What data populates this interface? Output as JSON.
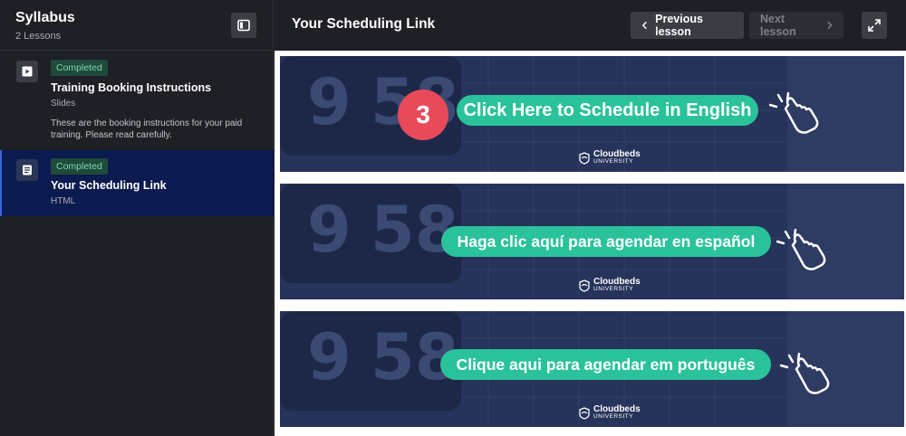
{
  "sidebar": {
    "title": "Syllabus",
    "subtitle": "2 Lessons",
    "lessons": [
      {
        "status": "Completed",
        "title": "Training Booking Instructions",
        "type": "Slides",
        "description": "These are the booking instructions for your paid training. Please read carefully.",
        "icon": "play-icon"
      },
      {
        "status": "Completed",
        "title": "Your Scheduling Link",
        "type": "HTML",
        "icon": "document-icon",
        "active": true
      }
    ]
  },
  "header": {
    "title": "Your Scheduling Link",
    "prev_label": "Previous lesson",
    "next_label": "Next lesson"
  },
  "banners": [
    {
      "number": "3",
      "label": "Click Here to Schedule in English"
    },
    {
      "label": "Haga clic aquí para agendar en español"
    },
    {
      "label": "Clique aqui para agendar em português"
    }
  ],
  "brand": {
    "name": "Cloudbeds",
    "sub": "UNIVERSITY"
  },
  "colors": {
    "sidebar_bg": "#1e2025",
    "active_lesson_bg": "#0c1b4f",
    "badge_bg": "#1e4a3b",
    "badge_text": "#7fd6ad",
    "pill": "#2ac29a",
    "number_circle": "#e84a5a",
    "banner_bg": "#26335a"
  }
}
